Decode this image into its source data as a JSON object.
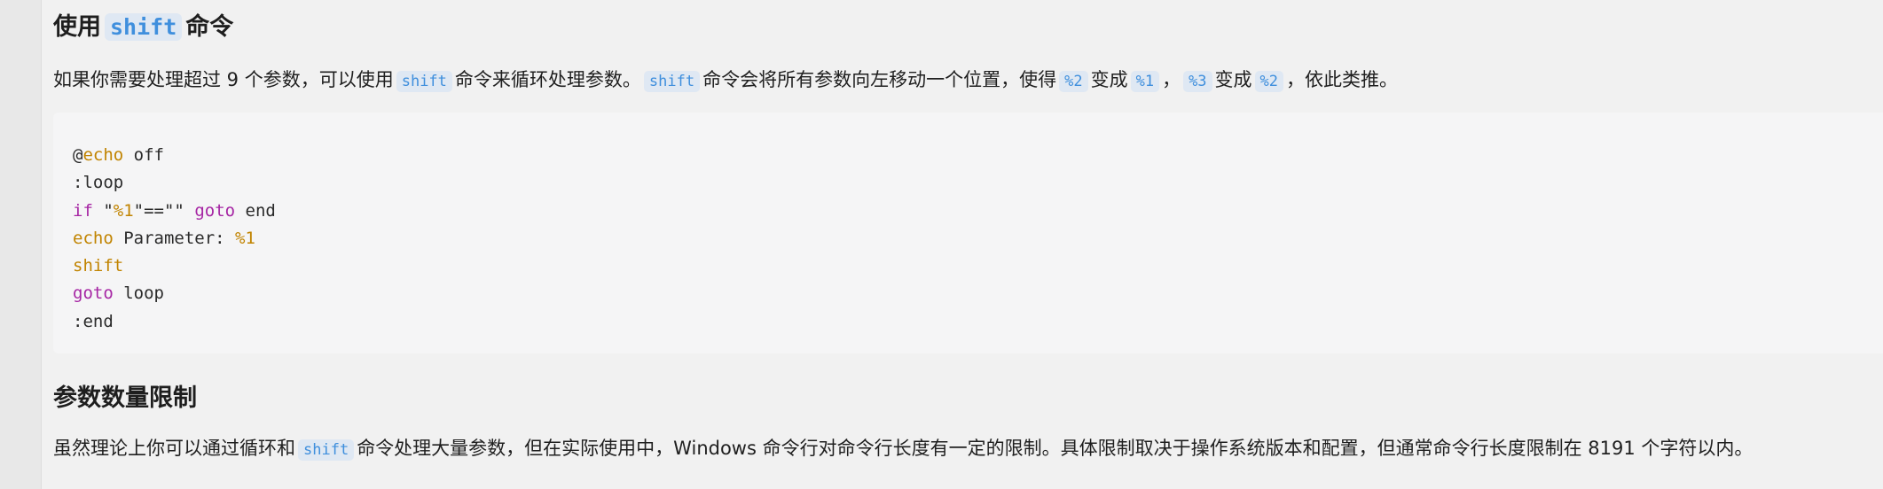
{
  "section1": {
    "heading_before": "使用",
    "heading_code": "shift",
    "heading_after": "命令",
    "para": {
      "t1": "如果你需要处理超过 9 个参数，可以使用",
      "c1": "shift",
      "t2": "命令来循环处理参数。",
      "c2": "shift",
      "t3": "命令会将所有参数向左移动一个位置，使得",
      "c3": "%2",
      "t4": "变成",
      "c4": "%1",
      "t5": "，",
      "c5": "%3",
      "t6": "变成",
      "c6": "%2",
      "t7": "，依此类推。"
    }
  },
  "code": {
    "l1_at": "@",
    "l1_cmd": "echo",
    "l1_rest": " off",
    "l2": ":loop",
    "l3_kw": "if",
    "l3_a": " \"",
    "l3_var": "%1",
    "l3_b": "\"==\"\" ",
    "l3_kw2": "goto",
    "l3_rest": " end",
    "l4_cmd": "echo",
    "l4_rest": " Parameter: ",
    "l4_var": "%1",
    "l5_cmd": "shift",
    "l6_kw": "goto",
    "l6_rest": " loop",
    "l7": ":end"
  },
  "section2": {
    "heading": "参数数量限制",
    "para": {
      "t1": "虽然理论上你可以通过循环和",
      "c1": "shift",
      "t2": "命令处理大量参数，但在实际使用中，Windows 命令行对命令行长度有一定的限制。具体限制取决于操作系统版本和配置，但通常命令行长度限制在 8191 个字符以内。"
    }
  }
}
